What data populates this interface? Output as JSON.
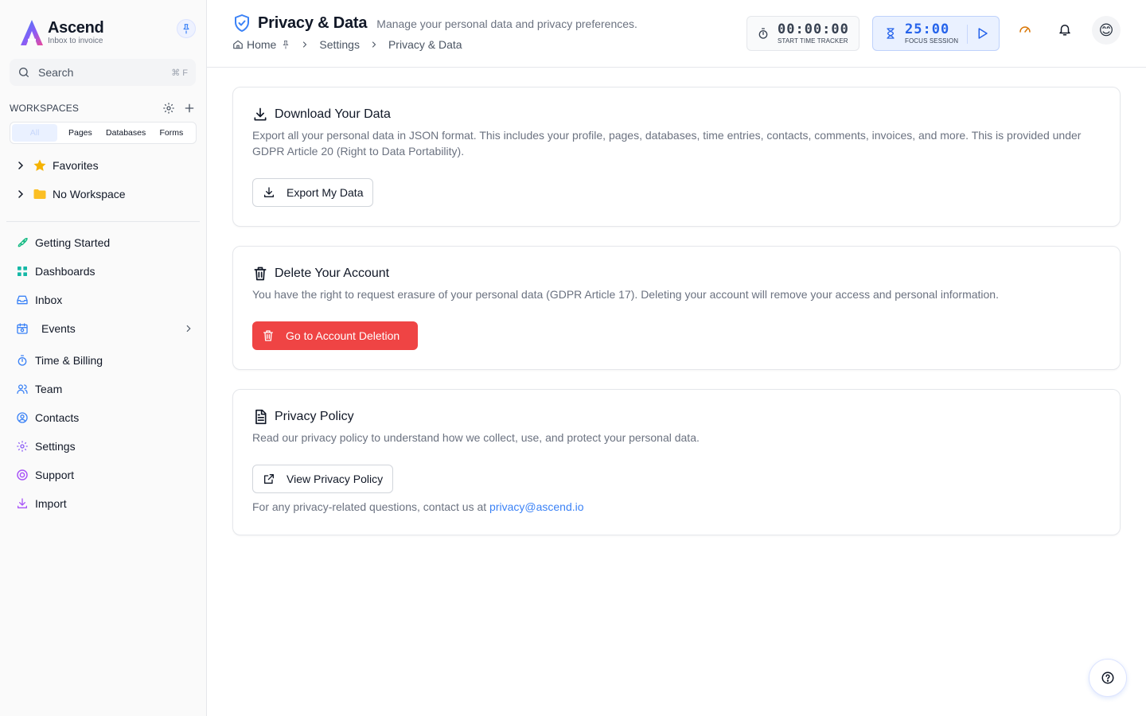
{
  "brand": {
    "name": "Ascend",
    "tagline": "Inbox to invoice",
    "gradient_start": "#3b82f6",
    "gradient_end": "#ec4899"
  },
  "sidebar": {
    "search_placeholder": "Search",
    "search_shortcut": "⌘ F",
    "workspaces_title": "WORKSPACES",
    "tabs": [
      "All",
      "Pages",
      "Databases",
      "Forms"
    ],
    "active_tab": "All",
    "tree": [
      {
        "label": "Favorites",
        "icon": "star-icon"
      },
      {
        "label": "No Workspace",
        "icon": "folder-icon"
      }
    ],
    "nav": [
      {
        "label": "Getting Started",
        "icon": "rocket-icon"
      },
      {
        "label": "Dashboards",
        "icon": "grid-icon"
      },
      {
        "label": "Inbox",
        "icon": "inbox-icon"
      },
      {
        "label": "Events",
        "icon": "calendar-icon"
      },
      {
        "label": "Time & Billing",
        "icon": "stopwatch-icon"
      },
      {
        "label": "Team",
        "icon": "users-icon"
      },
      {
        "label": "Contacts",
        "icon": "contact-icon"
      },
      {
        "label": "Settings",
        "icon": "gear-icon"
      },
      {
        "label": "Support",
        "icon": "lifebuoy-icon"
      },
      {
        "label": "Import",
        "icon": "download-icon"
      }
    ]
  },
  "header": {
    "title": "Privacy & Data",
    "subtitle": "Manage your personal data and privacy preferences.",
    "breadcrumb": [
      "Home",
      "Settings",
      "Privacy & Data"
    ],
    "timer": {
      "value": "00:00:00",
      "label": "START TIME TRACKER"
    },
    "focus": {
      "value": "25:00",
      "label": "FOCUS SESSION"
    },
    "avatar": "😊"
  },
  "cards": {
    "download": {
      "title": "Download Your Data",
      "description": "Export all your personal data in JSON format. This includes your profile, pages, databases, time entries, contacts, comments, invoices, and more. This is provided under GDPR Article 20 (Right to Data Portability).",
      "button": "Export My Data"
    },
    "delete": {
      "title": "Delete Your Account",
      "description": "You have the right to request erasure of your personal data (GDPR Article 17). Deleting your account will remove your access and personal information.",
      "button": "Go to Account Deletion"
    },
    "policy": {
      "title": "Privacy Policy",
      "description": "Read our privacy policy to understand how we collect, use, and protect your personal data.",
      "button": "View Privacy Policy",
      "contact_prefix": "For any privacy-related questions, contact us at",
      "contact_email": "privacy@ascend.io"
    }
  },
  "colors": {
    "accent": "#2563eb",
    "danger": "#ef4444",
    "link": "#3b82f6"
  }
}
